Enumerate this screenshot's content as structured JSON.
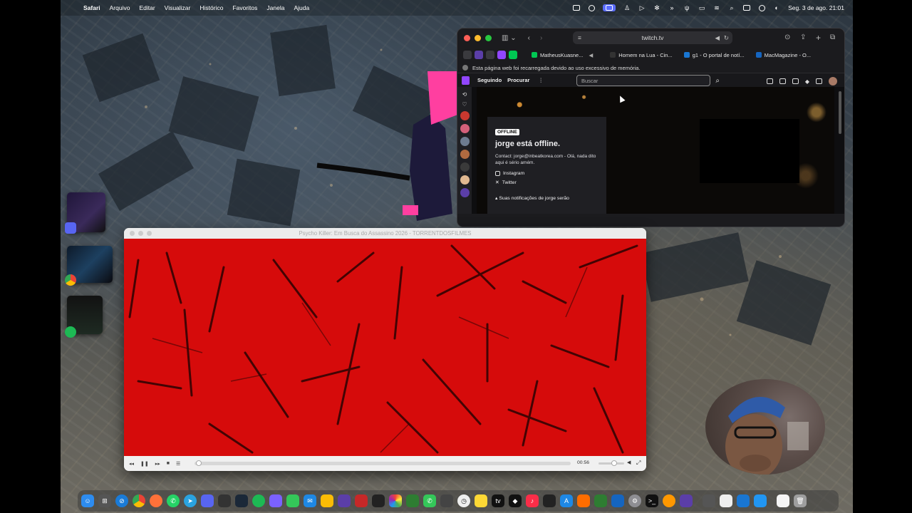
{
  "menubar": {
    "app_name": "Safari",
    "items": [
      "Arquivo",
      "Editar",
      "Visualizar",
      "Histórico",
      "Favoritos",
      "Janela",
      "Ajuda"
    ],
    "clock": "Seg. 3 de ago.  21:01"
  },
  "safari": {
    "url": "twitch.tv",
    "tabs": [
      {
        "label": "MatheusKuasne...",
        "fav_color": "#00c853"
      },
      {
        "label": "Homem na Lua - Cin...",
        "fav_color": "#333333"
      },
      {
        "label": "g1 - O portal de notí...",
        "fav_color": "#1976d2"
      },
      {
        "label": "MacMagazine - O...",
        "fav_color": "#1565c0"
      }
    ],
    "notice": "Esta página web foi recarregada devido ao uso excessivo de memória."
  },
  "twitch": {
    "nav": {
      "following": "Seguindo",
      "browse": "Procurar",
      "search_placeholder": "Buscar"
    },
    "offline_badge": "OFFLINE",
    "offline_title": "jorge está offline.",
    "contact": "Contact: jorge@inbeatkorea.com - Olá, nada dito aqui é sério amém.",
    "socials": [
      "Instagram",
      "Twitter"
    ],
    "notif_text": "Suas notificações de jorge serão"
  },
  "player": {
    "title": "Psycho Killer: Em Busca do Assassino 2026 - TORRENTDOSFILMES",
    "time": "00:56",
    "progress": 0.005
  },
  "colors": {
    "video_red": "#d60b0b",
    "twitch_purple": "#9146ff"
  }
}
